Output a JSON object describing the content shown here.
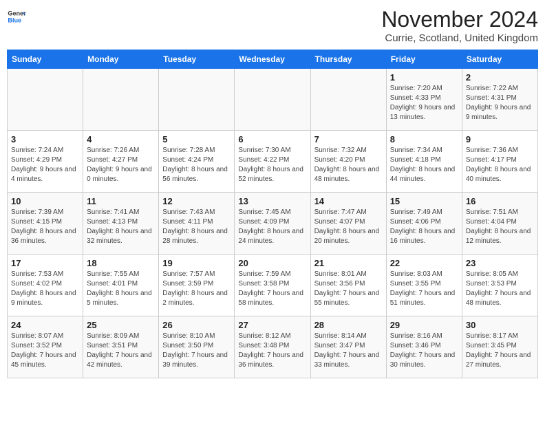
{
  "header": {
    "logo_line1": "General",
    "logo_line2": "Blue",
    "month": "November 2024",
    "location": "Currie, Scotland, United Kingdom"
  },
  "weekdays": [
    "Sunday",
    "Monday",
    "Tuesday",
    "Wednesday",
    "Thursday",
    "Friday",
    "Saturday"
  ],
  "weeks": [
    [
      {
        "day": "",
        "info": ""
      },
      {
        "day": "",
        "info": ""
      },
      {
        "day": "",
        "info": ""
      },
      {
        "day": "",
        "info": ""
      },
      {
        "day": "",
        "info": ""
      },
      {
        "day": "1",
        "info": "Sunrise: 7:20 AM\nSunset: 4:33 PM\nDaylight: 9 hours and 13 minutes."
      },
      {
        "day": "2",
        "info": "Sunrise: 7:22 AM\nSunset: 4:31 PM\nDaylight: 9 hours and 9 minutes."
      }
    ],
    [
      {
        "day": "3",
        "info": "Sunrise: 7:24 AM\nSunset: 4:29 PM\nDaylight: 9 hours and 4 minutes."
      },
      {
        "day": "4",
        "info": "Sunrise: 7:26 AM\nSunset: 4:27 PM\nDaylight: 9 hours and 0 minutes."
      },
      {
        "day": "5",
        "info": "Sunrise: 7:28 AM\nSunset: 4:24 PM\nDaylight: 8 hours and 56 minutes."
      },
      {
        "day": "6",
        "info": "Sunrise: 7:30 AM\nSunset: 4:22 PM\nDaylight: 8 hours and 52 minutes."
      },
      {
        "day": "7",
        "info": "Sunrise: 7:32 AM\nSunset: 4:20 PM\nDaylight: 8 hours and 48 minutes."
      },
      {
        "day": "8",
        "info": "Sunrise: 7:34 AM\nSunset: 4:18 PM\nDaylight: 8 hours and 44 minutes."
      },
      {
        "day": "9",
        "info": "Sunrise: 7:36 AM\nSunset: 4:17 PM\nDaylight: 8 hours and 40 minutes."
      }
    ],
    [
      {
        "day": "10",
        "info": "Sunrise: 7:39 AM\nSunset: 4:15 PM\nDaylight: 8 hours and 36 minutes."
      },
      {
        "day": "11",
        "info": "Sunrise: 7:41 AM\nSunset: 4:13 PM\nDaylight: 8 hours and 32 minutes."
      },
      {
        "day": "12",
        "info": "Sunrise: 7:43 AM\nSunset: 4:11 PM\nDaylight: 8 hours and 28 minutes."
      },
      {
        "day": "13",
        "info": "Sunrise: 7:45 AM\nSunset: 4:09 PM\nDaylight: 8 hours and 24 minutes."
      },
      {
        "day": "14",
        "info": "Sunrise: 7:47 AM\nSunset: 4:07 PM\nDaylight: 8 hours and 20 minutes."
      },
      {
        "day": "15",
        "info": "Sunrise: 7:49 AM\nSunset: 4:06 PM\nDaylight: 8 hours and 16 minutes."
      },
      {
        "day": "16",
        "info": "Sunrise: 7:51 AM\nSunset: 4:04 PM\nDaylight: 8 hours and 12 minutes."
      }
    ],
    [
      {
        "day": "17",
        "info": "Sunrise: 7:53 AM\nSunset: 4:02 PM\nDaylight: 8 hours and 9 minutes."
      },
      {
        "day": "18",
        "info": "Sunrise: 7:55 AM\nSunset: 4:01 PM\nDaylight: 8 hours and 5 minutes."
      },
      {
        "day": "19",
        "info": "Sunrise: 7:57 AM\nSunset: 3:59 PM\nDaylight: 8 hours and 2 minutes."
      },
      {
        "day": "20",
        "info": "Sunrise: 7:59 AM\nSunset: 3:58 PM\nDaylight: 7 hours and 58 minutes."
      },
      {
        "day": "21",
        "info": "Sunrise: 8:01 AM\nSunset: 3:56 PM\nDaylight: 7 hours and 55 minutes."
      },
      {
        "day": "22",
        "info": "Sunrise: 8:03 AM\nSunset: 3:55 PM\nDaylight: 7 hours and 51 minutes."
      },
      {
        "day": "23",
        "info": "Sunrise: 8:05 AM\nSunset: 3:53 PM\nDaylight: 7 hours and 48 minutes."
      }
    ],
    [
      {
        "day": "24",
        "info": "Sunrise: 8:07 AM\nSunset: 3:52 PM\nDaylight: 7 hours and 45 minutes."
      },
      {
        "day": "25",
        "info": "Sunrise: 8:09 AM\nSunset: 3:51 PM\nDaylight: 7 hours and 42 minutes."
      },
      {
        "day": "26",
        "info": "Sunrise: 8:10 AM\nSunset: 3:50 PM\nDaylight: 7 hours and 39 minutes."
      },
      {
        "day": "27",
        "info": "Sunrise: 8:12 AM\nSunset: 3:48 PM\nDaylight: 7 hours and 36 minutes."
      },
      {
        "day": "28",
        "info": "Sunrise: 8:14 AM\nSunset: 3:47 PM\nDaylight: 7 hours and 33 minutes."
      },
      {
        "day": "29",
        "info": "Sunrise: 8:16 AM\nSunset: 3:46 PM\nDaylight: 7 hours and 30 minutes."
      },
      {
        "day": "30",
        "info": "Sunrise: 8:17 AM\nSunset: 3:45 PM\nDaylight: 7 hours and 27 minutes."
      }
    ]
  ]
}
